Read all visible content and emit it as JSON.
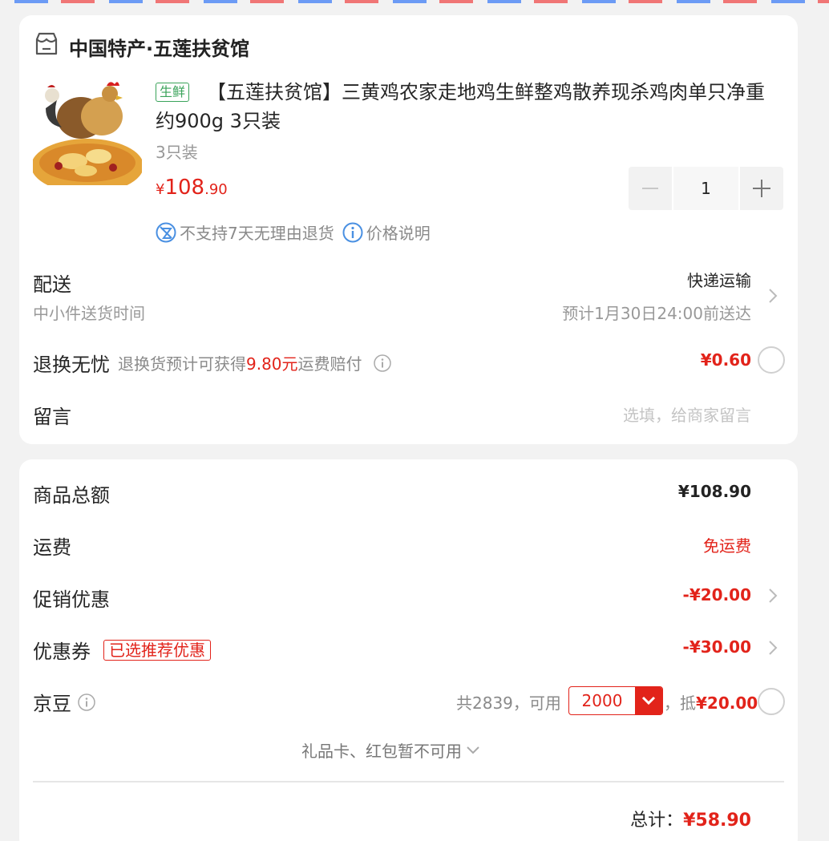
{
  "shop": {
    "name": "中国特产·五莲扶贫馆",
    "icon": "store-icon"
  },
  "product": {
    "tag": "生鲜",
    "title": "【五莲扶贫馆】三黄鸡农家走地鸡生鲜整鸡散养现杀鸡肉单只净重约900g 3只装",
    "spec": "3只装",
    "price_currency": "¥",
    "price_int": "108",
    "price_dec": ".90",
    "quantity": "1",
    "no_return": "不支持7天无理由退货",
    "price_note": "价格说明"
  },
  "delivery": {
    "label": "配送",
    "method": "快递运输",
    "sub_label": "中小件送货时间",
    "eta": "预计1月30日24:00前送达"
  },
  "return_insurance": {
    "label": "退换无忧",
    "desc_prefix": "退换货预计可获得",
    "desc_amount": "9.80元",
    "desc_suffix": "运费赔付",
    "price": "¥0.60"
  },
  "message": {
    "label": "留言",
    "placeholder": "选填，给商家留言"
  },
  "summary": {
    "goods_total_label": "商品总额",
    "goods_total": "¥108.90",
    "shipping_label": "运费",
    "shipping": "免运费",
    "promo_label": "促销优惠",
    "promo": "-¥20.00",
    "coupon_label": "优惠券",
    "coupon_tag": "已选推荐优惠",
    "coupon": "-¥30.00",
    "beans_label": "京豆",
    "beans_total": "共2839，可用",
    "beans_value": "2000",
    "beans_deduct_prefix": "，抵",
    "beans_deduct": "¥20.00",
    "gift_note": "礼品卡、红包暂不可用",
    "total_label": "总计：",
    "total": "¥58.90"
  },
  "colors": {
    "accent": "#e2231a",
    "fresh_tag": "#3aa35a",
    "link_blue": "#4a90e2",
    "background": "#f2f2f2"
  }
}
